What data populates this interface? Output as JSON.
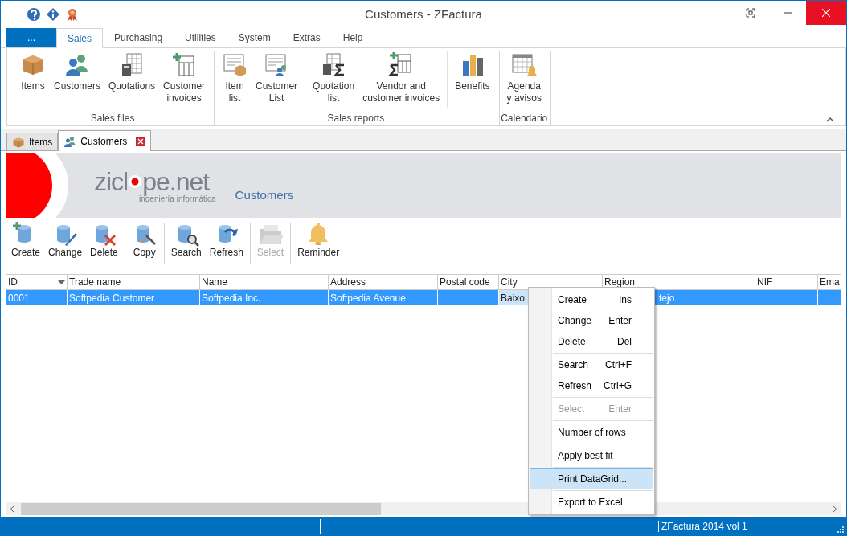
{
  "window": {
    "title": "Customers - ZFactura"
  },
  "ribbon_tabs": [
    {
      "label": "...",
      "kind": "file",
      "selected": false
    },
    {
      "label": "Sales",
      "kind": "tab",
      "selected": true
    },
    {
      "label": "Purchasing",
      "kind": "tab",
      "selected": false
    },
    {
      "label": "Utilities",
      "kind": "tab",
      "selected": false
    },
    {
      "label": "System",
      "kind": "tab",
      "selected": false
    },
    {
      "label": "Extras",
      "kind": "tab",
      "selected": false
    },
    {
      "label": "Help",
      "kind": "tab",
      "selected": false
    }
  ],
  "ribbon_groups": [
    {
      "label": "Sales files",
      "sections": [
        [
          "Items",
          "Customers",
          "Quotations",
          "Customer\ninvoices"
        ]
      ]
    },
    {
      "label": "Sales reports",
      "sections": [
        [
          "Item\nlist",
          "Customer\nList"
        ],
        [
          "Quotation\nlist",
          "Vendor and\ncustomer invoices"
        ],
        [
          "Benefits"
        ]
      ]
    },
    {
      "label": "Calendario",
      "sections": [
        [
          "Agenda\ny avisos"
        ]
      ]
    }
  ],
  "doc_tabs": [
    {
      "label": "Items",
      "selected": false,
      "closable": false
    },
    {
      "label": "Customers",
      "selected": true,
      "closable": true
    }
  ],
  "banner": {
    "logo_start": "zicl",
    "logo_end": "pe.net",
    "tagline": "ingeniería informática",
    "title": "Customers"
  },
  "toolbar": [
    [
      {
        "label": "Create",
        "disabled": false
      },
      {
        "label": "Change",
        "disabled": false
      },
      {
        "label": "Delete",
        "disabled": false
      }
    ],
    [
      {
        "label": "Copy",
        "disabled": false
      }
    ],
    [
      {
        "label": "Search",
        "disabled": false
      },
      {
        "label": "Refresh",
        "disabled": false
      }
    ],
    [
      {
        "label": "Select",
        "disabled": true
      }
    ],
    [
      {
        "label": "Reminder",
        "disabled": false
      }
    ]
  ],
  "table": {
    "columns": [
      {
        "label": "ID",
        "sorted": true
      },
      {
        "label": "Trade name",
        "sorted": false
      },
      {
        "label": "Name",
        "sorted": false
      },
      {
        "label": "Address",
        "sorted": false
      },
      {
        "label": "Postal code",
        "sorted": false
      },
      {
        "label": "City",
        "sorted": false
      },
      {
        "label": "Region",
        "sorted": false
      },
      {
        "label": "NIF",
        "sorted": false
      },
      {
        "label": "Ema",
        "sorted": false
      }
    ],
    "rows": [
      {
        "selected": true,
        "cells": [
          "0001",
          "Softpedia Customer",
          "Softpedia Inc.",
          "Softpedia Avenue",
          "",
          "Baixo",
          "tejo",
          "",
          ""
        ]
      }
    ]
  },
  "context_menu": [
    [
      {
        "label": "Create",
        "shortcut": "Ins",
        "disabled": false,
        "selected": false
      },
      {
        "label": "Change",
        "shortcut": "Enter",
        "disabled": false,
        "selected": false
      },
      {
        "label": "Delete",
        "shortcut": "Del",
        "disabled": false,
        "selected": false
      }
    ],
    [
      {
        "label": "Search",
        "shortcut": "Ctrl+F",
        "disabled": false,
        "selected": false
      },
      {
        "label": "Refresh",
        "shortcut": "Ctrl+G",
        "disabled": false,
        "selected": false
      }
    ],
    [
      {
        "label": "Select",
        "shortcut": "Enter",
        "disabled": true,
        "selected": false
      }
    ],
    [
      {
        "label": "Number of rows",
        "disabled": false,
        "selected": false
      }
    ],
    [
      {
        "label": "Apply best fit",
        "disabled": false,
        "selected": false
      }
    ],
    [
      {
        "label": "Print DataGrid...",
        "disabled": false,
        "selected": true
      }
    ],
    [
      {
        "label": "Export to Excel",
        "disabled": false,
        "selected": false
      }
    ]
  ],
  "status_bar": {
    "text": "ZFactura 2014 vol 1"
  }
}
